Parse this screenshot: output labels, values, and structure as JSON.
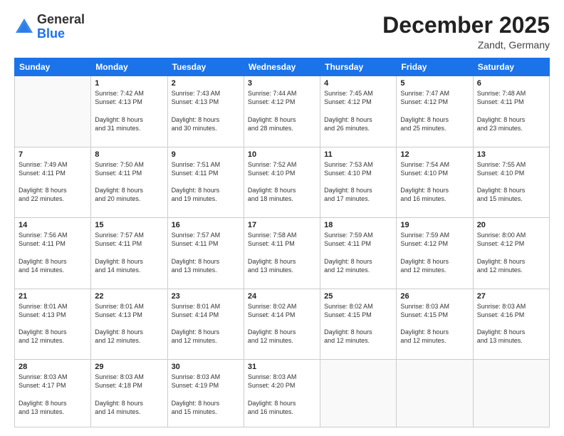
{
  "header": {
    "logo_general": "General",
    "logo_blue": "Blue",
    "month_title": "December 2025",
    "location": "Zandt, Germany"
  },
  "days_of_week": [
    "Sunday",
    "Monday",
    "Tuesday",
    "Wednesday",
    "Thursday",
    "Friday",
    "Saturday"
  ],
  "weeks": [
    [
      {
        "day": "",
        "sunrise": "",
        "sunset": "",
        "daylight": ""
      },
      {
        "day": "1",
        "sunrise": "Sunrise: 7:42 AM",
        "sunset": "Sunset: 4:13 PM",
        "daylight": "Daylight: 8 hours and 31 minutes."
      },
      {
        "day": "2",
        "sunrise": "Sunrise: 7:43 AM",
        "sunset": "Sunset: 4:13 PM",
        "daylight": "Daylight: 8 hours and 30 minutes."
      },
      {
        "day": "3",
        "sunrise": "Sunrise: 7:44 AM",
        "sunset": "Sunset: 4:12 PM",
        "daylight": "Daylight: 8 hours and 28 minutes."
      },
      {
        "day": "4",
        "sunrise": "Sunrise: 7:45 AM",
        "sunset": "Sunset: 4:12 PM",
        "daylight": "Daylight: 8 hours and 26 minutes."
      },
      {
        "day": "5",
        "sunrise": "Sunrise: 7:47 AM",
        "sunset": "Sunset: 4:12 PM",
        "daylight": "Daylight: 8 hours and 25 minutes."
      },
      {
        "day": "6",
        "sunrise": "Sunrise: 7:48 AM",
        "sunset": "Sunset: 4:11 PM",
        "daylight": "Daylight: 8 hours and 23 minutes."
      }
    ],
    [
      {
        "day": "7",
        "sunrise": "Sunrise: 7:49 AM",
        "sunset": "Sunset: 4:11 PM",
        "daylight": "Daylight: 8 hours and 22 minutes."
      },
      {
        "day": "8",
        "sunrise": "Sunrise: 7:50 AM",
        "sunset": "Sunset: 4:11 PM",
        "daylight": "Daylight: 8 hours and 20 minutes."
      },
      {
        "day": "9",
        "sunrise": "Sunrise: 7:51 AM",
        "sunset": "Sunset: 4:11 PM",
        "daylight": "Daylight: 8 hours and 19 minutes."
      },
      {
        "day": "10",
        "sunrise": "Sunrise: 7:52 AM",
        "sunset": "Sunset: 4:10 PM",
        "daylight": "Daylight: 8 hours and 18 minutes."
      },
      {
        "day": "11",
        "sunrise": "Sunrise: 7:53 AM",
        "sunset": "Sunset: 4:10 PM",
        "daylight": "Daylight: 8 hours and 17 minutes."
      },
      {
        "day": "12",
        "sunrise": "Sunrise: 7:54 AM",
        "sunset": "Sunset: 4:10 PM",
        "daylight": "Daylight: 8 hours and 16 minutes."
      },
      {
        "day": "13",
        "sunrise": "Sunrise: 7:55 AM",
        "sunset": "Sunset: 4:10 PM",
        "daylight": "Daylight: 8 hours and 15 minutes."
      }
    ],
    [
      {
        "day": "14",
        "sunrise": "Sunrise: 7:56 AM",
        "sunset": "Sunset: 4:11 PM",
        "daylight": "Daylight: 8 hours and 14 minutes."
      },
      {
        "day": "15",
        "sunrise": "Sunrise: 7:57 AM",
        "sunset": "Sunset: 4:11 PM",
        "daylight": "Daylight: 8 hours and 14 minutes."
      },
      {
        "day": "16",
        "sunrise": "Sunrise: 7:57 AM",
        "sunset": "Sunset: 4:11 PM",
        "daylight": "Daylight: 8 hours and 13 minutes."
      },
      {
        "day": "17",
        "sunrise": "Sunrise: 7:58 AM",
        "sunset": "Sunset: 4:11 PM",
        "daylight": "Daylight: 8 hours and 13 minutes."
      },
      {
        "day": "18",
        "sunrise": "Sunrise: 7:59 AM",
        "sunset": "Sunset: 4:11 PM",
        "daylight": "Daylight: 8 hours and 12 minutes."
      },
      {
        "day": "19",
        "sunrise": "Sunrise: 7:59 AM",
        "sunset": "Sunset: 4:12 PM",
        "daylight": "Daylight: 8 hours and 12 minutes."
      },
      {
        "day": "20",
        "sunrise": "Sunrise: 8:00 AM",
        "sunset": "Sunset: 4:12 PM",
        "daylight": "Daylight: 8 hours and 12 minutes."
      }
    ],
    [
      {
        "day": "21",
        "sunrise": "Sunrise: 8:01 AM",
        "sunset": "Sunset: 4:13 PM",
        "daylight": "Daylight: 8 hours and 12 minutes."
      },
      {
        "day": "22",
        "sunrise": "Sunrise: 8:01 AM",
        "sunset": "Sunset: 4:13 PM",
        "daylight": "Daylight: 8 hours and 12 minutes."
      },
      {
        "day": "23",
        "sunrise": "Sunrise: 8:01 AM",
        "sunset": "Sunset: 4:14 PM",
        "daylight": "Daylight: 8 hours and 12 minutes."
      },
      {
        "day": "24",
        "sunrise": "Sunrise: 8:02 AM",
        "sunset": "Sunset: 4:14 PM",
        "daylight": "Daylight: 8 hours and 12 minutes."
      },
      {
        "day": "25",
        "sunrise": "Sunrise: 8:02 AM",
        "sunset": "Sunset: 4:15 PM",
        "daylight": "Daylight: 8 hours and 12 minutes."
      },
      {
        "day": "26",
        "sunrise": "Sunrise: 8:03 AM",
        "sunset": "Sunset: 4:15 PM",
        "daylight": "Daylight: 8 hours and 12 minutes."
      },
      {
        "day": "27",
        "sunrise": "Sunrise: 8:03 AM",
        "sunset": "Sunset: 4:16 PM",
        "daylight": "Daylight: 8 hours and 13 minutes."
      }
    ],
    [
      {
        "day": "28",
        "sunrise": "Sunrise: 8:03 AM",
        "sunset": "Sunset: 4:17 PM",
        "daylight": "Daylight: 8 hours and 13 minutes."
      },
      {
        "day": "29",
        "sunrise": "Sunrise: 8:03 AM",
        "sunset": "Sunset: 4:18 PM",
        "daylight": "Daylight: 8 hours and 14 minutes."
      },
      {
        "day": "30",
        "sunrise": "Sunrise: 8:03 AM",
        "sunset": "Sunset: 4:19 PM",
        "daylight": "Daylight: 8 hours and 15 minutes."
      },
      {
        "day": "31",
        "sunrise": "Sunrise: 8:03 AM",
        "sunset": "Sunset: 4:20 PM",
        "daylight": "Daylight: 8 hours and 16 minutes."
      },
      {
        "day": "",
        "sunrise": "",
        "sunset": "",
        "daylight": ""
      },
      {
        "day": "",
        "sunrise": "",
        "sunset": "",
        "daylight": ""
      },
      {
        "day": "",
        "sunrise": "",
        "sunset": "",
        "daylight": ""
      }
    ]
  ]
}
